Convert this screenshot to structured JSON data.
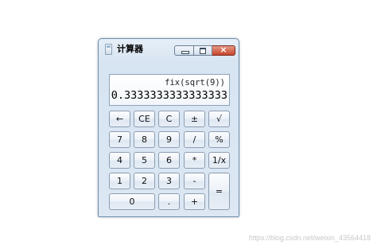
{
  "window": {
    "title": "计算器",
    "icon": "calculator-icon",
    "controls": {
      "minimize": "minimize-icon",
      "maximize": "maximize-icon",
      "close": "×"
    }
  },
  "display": {
    "expression": "fix(sqrt(9))",
    "value": "0.3333333333333333"
  },
  "keys": {
    "backspace": "←",
    "ce": "CE",
    "c": "C",
    "plusminus": "±",
    "sqrt": "√",
    "n7": "7",
    "n8": "8",
    "n9": "9",
    "divide": "/",
    "percent": "%",
    "n4": "4",
    "n5": "5",
    "n6": "6",
    "multiply": "*",
    "reciprocal": "1/x",
    "n1": "1",
    "n2": "2",
    "n3": "3",
    "minus": "-",
    "equals": "=",
    "n0": "0",
    "decimal": ".",
    "plus": "+"
  },
  "watermark": "https://blog.csdn.net/weixin_43564418"
}
